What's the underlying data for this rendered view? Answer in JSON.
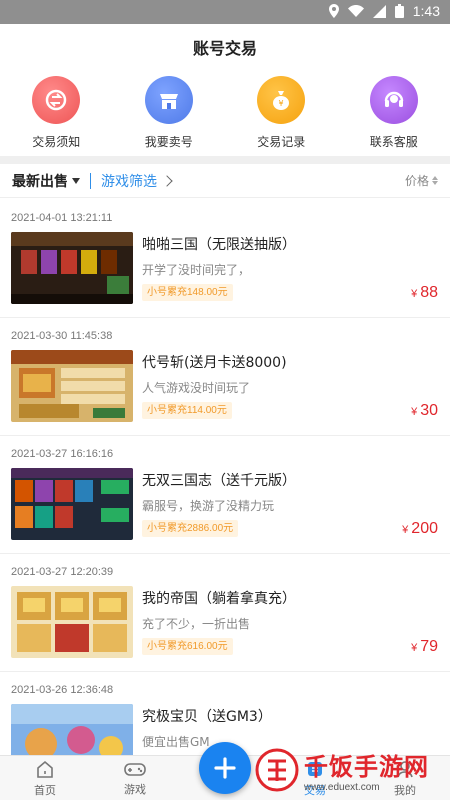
{
  "status_bar": {
    "time": "1:43"
  },
  "header": {
    "title": "账号交易"
  },
  "quick_actions": [
    {
      "label": "交易须知",
      "icon": "exchange-icon",
      "color": "#f36b6b"
    },
    {
      "label": "我要卖号",
      "icon": "store-icon",
      "color": "#5b88f0"
    },
    {
      "label": "交易记录",
      "icon": "money-bag-icon",
      "color": "#f5a623"
    },
    {
      "label": "联系客服",
      "icon": "headset-icon",
      "color": "#a55ce8"
    }
  ],
  "filter_bar": {
    "latest": "最新出售",
    "game_filter": "游戏筛选",
    "price_sort": "价格"
  },
  "listings": [
    {
      "date": "2021-04-01 13:21:11",
      "name": "啪啪三国（无限送抽版）",
      "desc": "开学了没时间完了，",
      "tag": "小号累充148.00元",
      "price_symbol": "¥",
      "price": "88"
    },
    {
      "date": "2021-03-30 11:45:38",
      "name": "代号斩(送月卡送8000)",
      "desc": "人气游戏没时间玩了",
      "tag": "小号累充114.00元",
      "price_symbol": "¥",
      "price": "30"
    },
    {
      "date": "2021-03-27 16:16:16",
      "name": "无双三国志（送千元版）",
      "desc": "霸服号，换游了没精力玩",
      "tag": "小号累充2886.00元",
      "price_symbol": "¥",
      "price": "200"
    },
    {
      "date": "2021-03-27 12:20:39",
      "name": "我的帝国（躺着拿真充）",
      "desc": "充了不少，一折出售",
      "tag": "小号累充616.00元",
      "price_symbol": "¥",
      "price": "79"
    },
    {
      "date": "2021-03-26 12:36:48",
      "name": "究极宝贝（送GM3）",
      "desc": "便宜出售GM",
      "tag": "",
      "price_symbol": "",
      "price": ""
    }
  ],
  "bottom_nav": [
    {
      "label": "首页",
      "icon": "home-icon"
    },
    {
      "label": "游戏",
      "icon": "gamepad-icon"
    },
    {
      "label": "交易",
      "icon": "trade-icon"
    },
    {
      "label": "我的",
      "icon": "user-icon"
    }
  ],
  "watermark": {
    "text": "千饭手游网",
    "url": "www.eduext.com"
  },
  "colors": {
    "accent": "#2f8ee8",
    "price": "#e0262c",
    "tag": "#f19a2a"
  }
}
